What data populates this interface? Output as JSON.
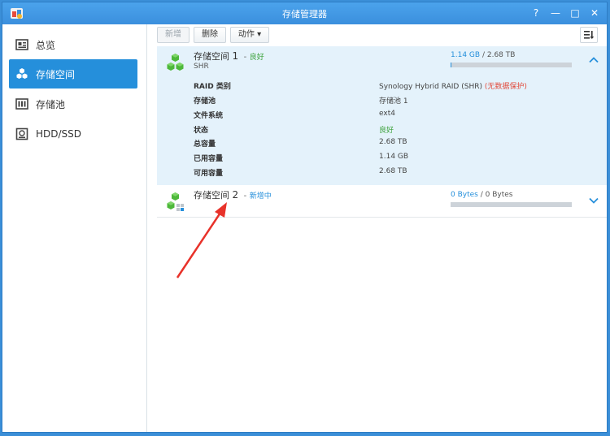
{
  "window": {
    "title": "存储管理器"
  },
  "titlebar_controls": {
    "help": "?",
    "minimize": "—",
    "maximize": "□",
    "close": "✕"
  },
  "sidebar": {
    "items": [
      {
        "label": "总览",
        "icon": "overview-icon",
        "active": false
      },
      {
        "label": "存储空间",
        "icon": "volume-icon",
        "active": true
      },
      {
        "label": "存储池",
        "icon": "storage-pool-icon",
        "active": false
      },
      {
        "label": "HDD/SSD",
        "icon": "hdd-icon",
        "active": false
      }
    ]
  },
  "toolbar": {
    "create_label": "新增",
    "delete_label": "删除",
    "action_label": "动作 ▾",
    "sort_icon": "sort-icon"
  },
  "volumes": [
    {
      "name": "存储空间",
      "number": "1",
      "separator": "-",
      "status": "良好",
      "type": "SHR",
      "used": "1.14 GB",
      "slash": "/",
      "total": "2.68 TB",
      "fill_fraction": 0.0004,
      "expanded": true,
      "details": [
        {
          "label": "RAID 类别",
          "value": "Synology Hybrid RAID (SHR)",
          "extra": "(无数据保护)"
        },
        {
          "label": "存储池",
          "value": "存储池 1"
        },
        {
          "label": "文件系统",
          "value": "ext4"
        },
        {
          "label": "状态",
          "value": "良好"
        },
        {
          "label": "总容量",
          "value": "2.68 TB"
        },
        {
          "label": "已用容量",
          "value": "1.14 GB"
        },
        {
          "label": "可用容量",
          "value": "2.68 TB"
        }
      ]
    },
    {
      "name": "存储空间",
      "number": "2",
      "separator": "-",
      "status": "新增中",
      "used": "0 Bytes",
      "slash": "/",
      "total": "0 Bytes",
      "fill_fraction": 0,
      "expanded": false
    }
  ],
  "colors": {
    "accent": "#258fdb",
    "good": "#3aa13a",
    "warn": "#e24a3b",
    "annotation_arrow": "#e8322a"
  }
}
